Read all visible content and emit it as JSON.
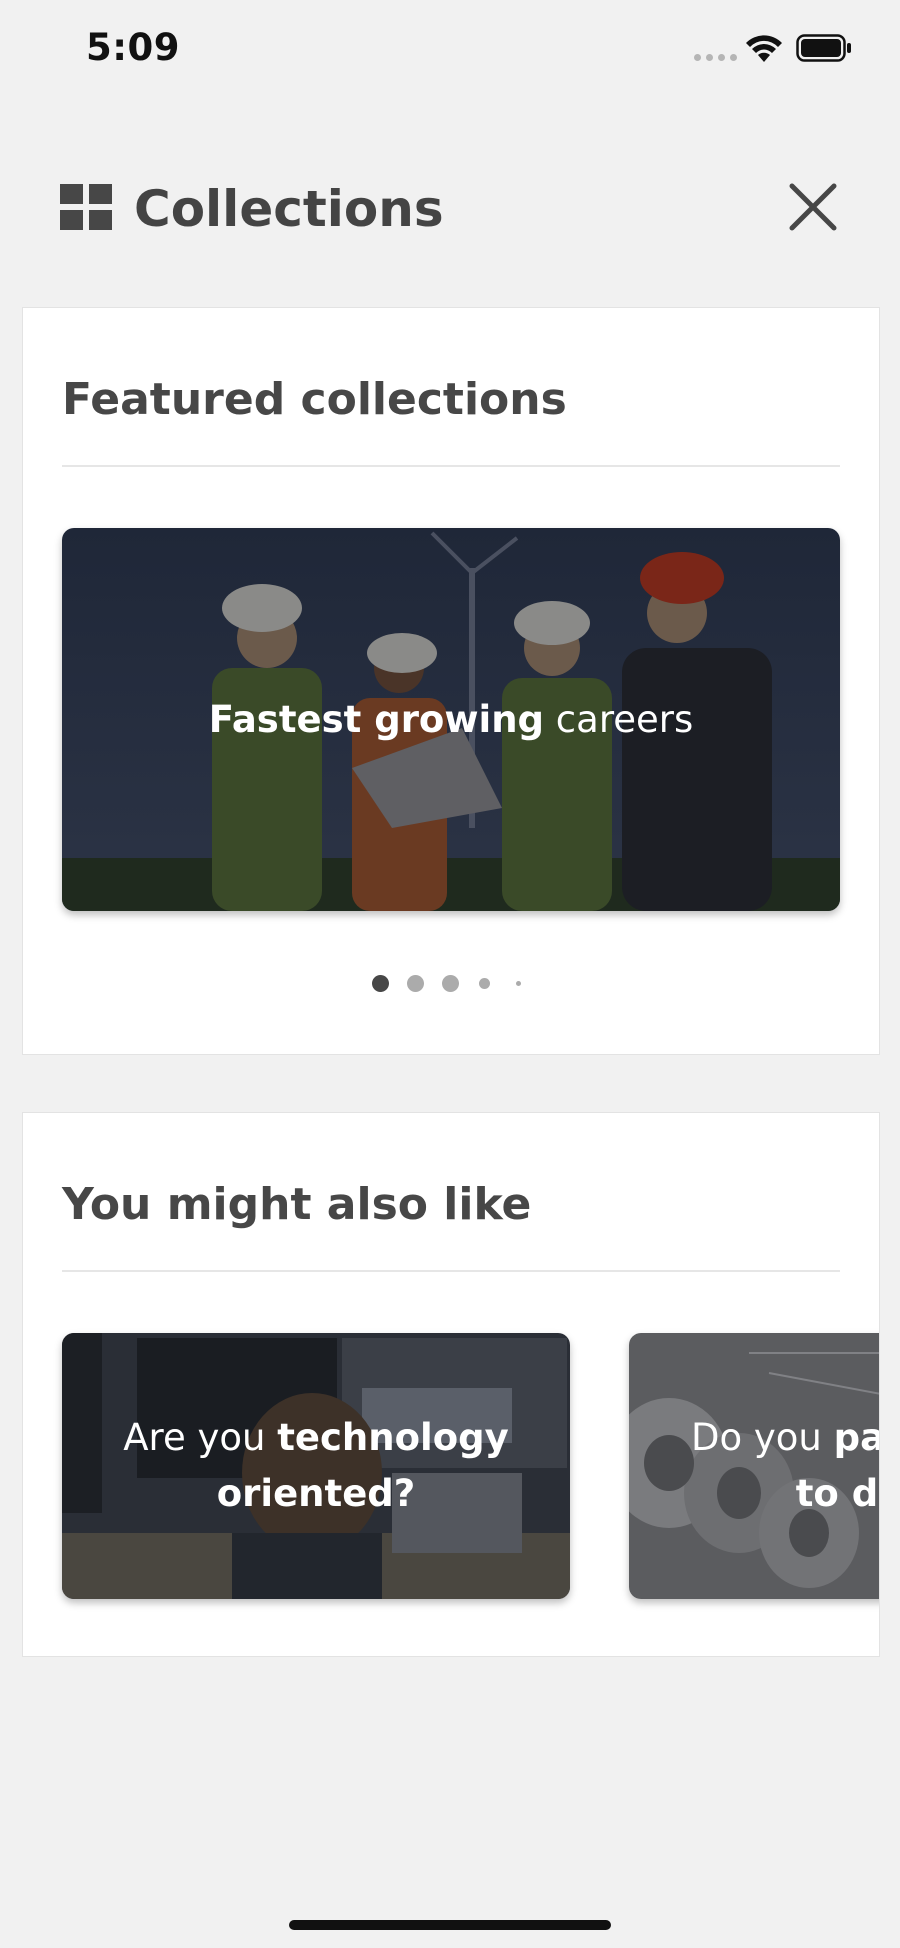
{
  "status_bar": {
    "time": "5:09"
  },
  "header": {
    "title": "Collections",
    "icon": "grid-icon",
    "close_icon": "close-icon"
  },
  "featured": {
    "title": "Featured collections",
    "slide": {
      "bold": "Fastest growing",
      "regular": " careers"
    },
    "pagination": {
      "count": 5,
      "active_index": 0
    }
  },
  "also_like": {
    "title": "You might also like",
    "cards": [
      {
        "pre": "Are you ",
        "bold_line1": "technology",
        "bold_line2": "oriented?"
      },
      {
        "pre": "Do you ",
        "bold_line1": "pay",
        "bold_line2": "to de"
      }
    ]
  }
}
